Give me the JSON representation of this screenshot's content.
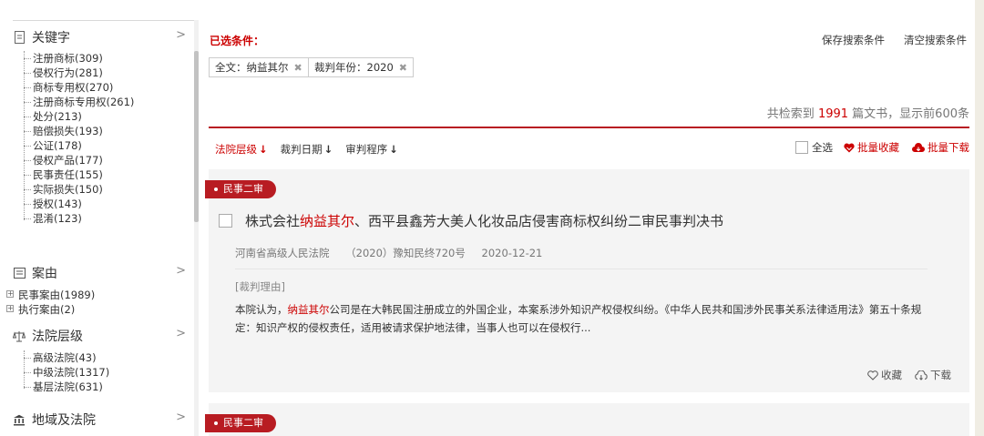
{
  "sidebar": {
    "sections": [
      {
        "title": "关键字",
        "arrow": ">",
        "items": [
          "注册商标(309)",
          "侵权行为(281)",
          "商标专用权(270)",
          "注册商标专用权(261)",
          "处分(213)",
          "赔偿损失(193)",
          "公证(178)",
          "侵权产品(177)",
          "民事责任(155)",
          "实际损失(150)",
          "授权(143)",
          "混淆(123)"
        ]
      },
      {
        "title": "案由",
        "arrow": ">",
        "items": [
          "民事案由(1989)",
          "执行案由(2)"
        ]
      },
      {
        "title": "法院层级",
        "arrow": ">",
        "items": [
          "高级法院(43)",
          "中级法院(1317)",
          "基层法院(631)"
        ]
      },
      {
        "title": "地域及法院",
        "arrow": ">",
        "items": []
      }
    ]
  },
  "conditions": {
    "label": "已选条件：",
    "save": "保存搜索条件",
    "clear": "清空搜索条件",
    "chips": [
      {
        "text": "全文：纳益其尔",
        "x": "✖"
      },
      {
        "text": "裁判年份：2020",
        "x": "✖"
      }
    ]
  },
  "results": {
    "prefix": "共检索到",
    "count": "1991",
    "suffix": "篇文书，显示前600条"
  },
  "sort": {
    "items": [
      {
        "label": "法院层级",
        "arrow": "↓"
      },
      {
        "label": "裁判日期",
        "arrow": "↓"
      },
      {
        "label": "审判程序",
        "arrow": "↓"
      }
    ],
    "select_all": "全选",
    "batch_fav": "批量收藏",
    "batch_download": "批量下载"
  },
  "cards": [
    {
      "tag": "民事二审",
      "title_pre": "株式会社",
      "title_hl": "纳益其尔",
      "title_post": "、西平县鑫芳大美人化妆品店侵害商标权纠纷二审民事判决书",
      "court": "河南省高级人民法院",
      "case_no": "（2020）豫知民终720号",
      "date": "2020-12-21",
      "reason_label": "[裁判理由]",
      "body_pre": "本院认为，",
      "body_hl": "纳益其尔",
      "body_post": "公司是在大韩民国注册成立的外国企业，本案系涉外知识产权侵权纠纷。《中华人民共和国涉外民事关系法律适用法》第五十条规定：知识产权的侵权责任，适用被请求保护地法律，当事人也可以在侵权行...",
      "fav": "收藏",
      "download": "下载"
    },
    {
      "tag": "民事二审"
    }
  ],
  "colors": {
    "accent": "#b81c22",
    "highlight": "#cc0000"
  }
}
